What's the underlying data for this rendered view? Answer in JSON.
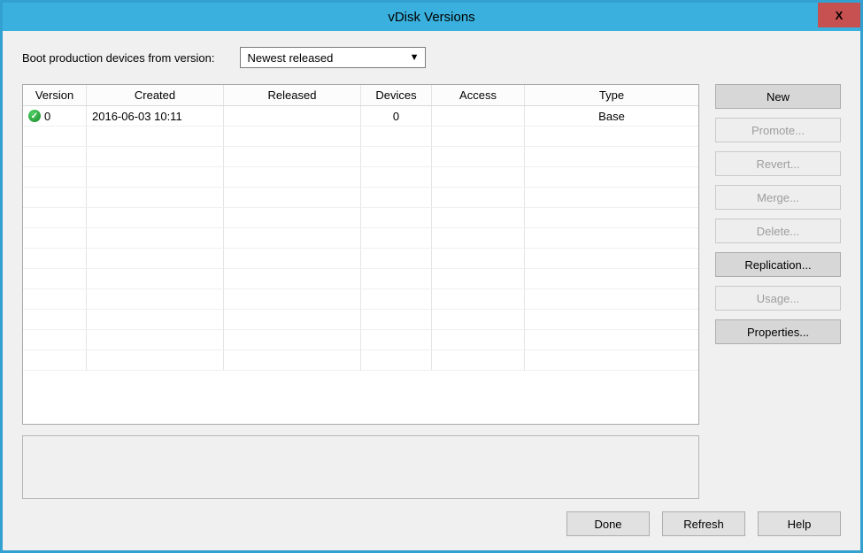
{
  "window": {
    "title": "vDisk Versions"
  },
  "boot": {
    "label": "Boot production devices from version:",
    "selected": "Newest released"
  },
  "grid": {
    "headers": {
      "version": "Version",
      "created": "Created",
      "released": "Released",
      "devices": "Devices",
      "access": "Access",
      "type": "Type"
    },
    "row0": {
      "status": "ok",
      "version": "0",
      "created": "2016-06-03 10:11",
      "released": "",
      "devices": "0",
      "access": "",
      "type": "Base"
    }
  },
  "side": {
    "new": "New",
    "promote": "Promote...",
    "revert": "Revert...",
    "merge": "Merge...",
    "delete": "Delete...",
    "replication": "Replication...",
    "usage": "Usage...",
    "properties": "Properties..."
  },
  "bottom": {
    "done": "Done",
    "refresh": "Refresh",
    "help": "Help"
  }
}
